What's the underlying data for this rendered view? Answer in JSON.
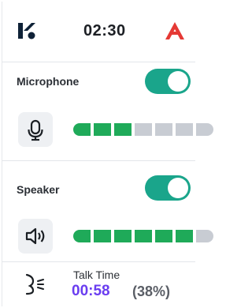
{
  "header": {
    "clock": "02:30",
    "left_logo_icon": "k-logo-icon",
    "right_logo_icon": "a-logo-icon"
  },
  "microphone": {
    "label": "Microphone",
    "enabled": true,
    "icon": "microphone-icon",
    "level_segments_on": 3,
    "level_segments_total": 7
  },
  "speaker": {
    "label": "Speaker",
    "enabled": true,
    "icon": "speaker-icon",
    "level_segments_on": 6,
    "level_segments_total": 7
  },
  "talk": {
    "label": "Talk Time",
    "time": "00:58",
    "percent": "(38%)",
    "icon": "talk-icon"
  },
  "colors": {
    "toggle_on": "#1aa58b",
    "meter_on": "#1faa59",
    "meter_off": "#c8ccd3",
    "talk_time": "#6a3df0",
    "brand_red": "#e53935"
  }
}
